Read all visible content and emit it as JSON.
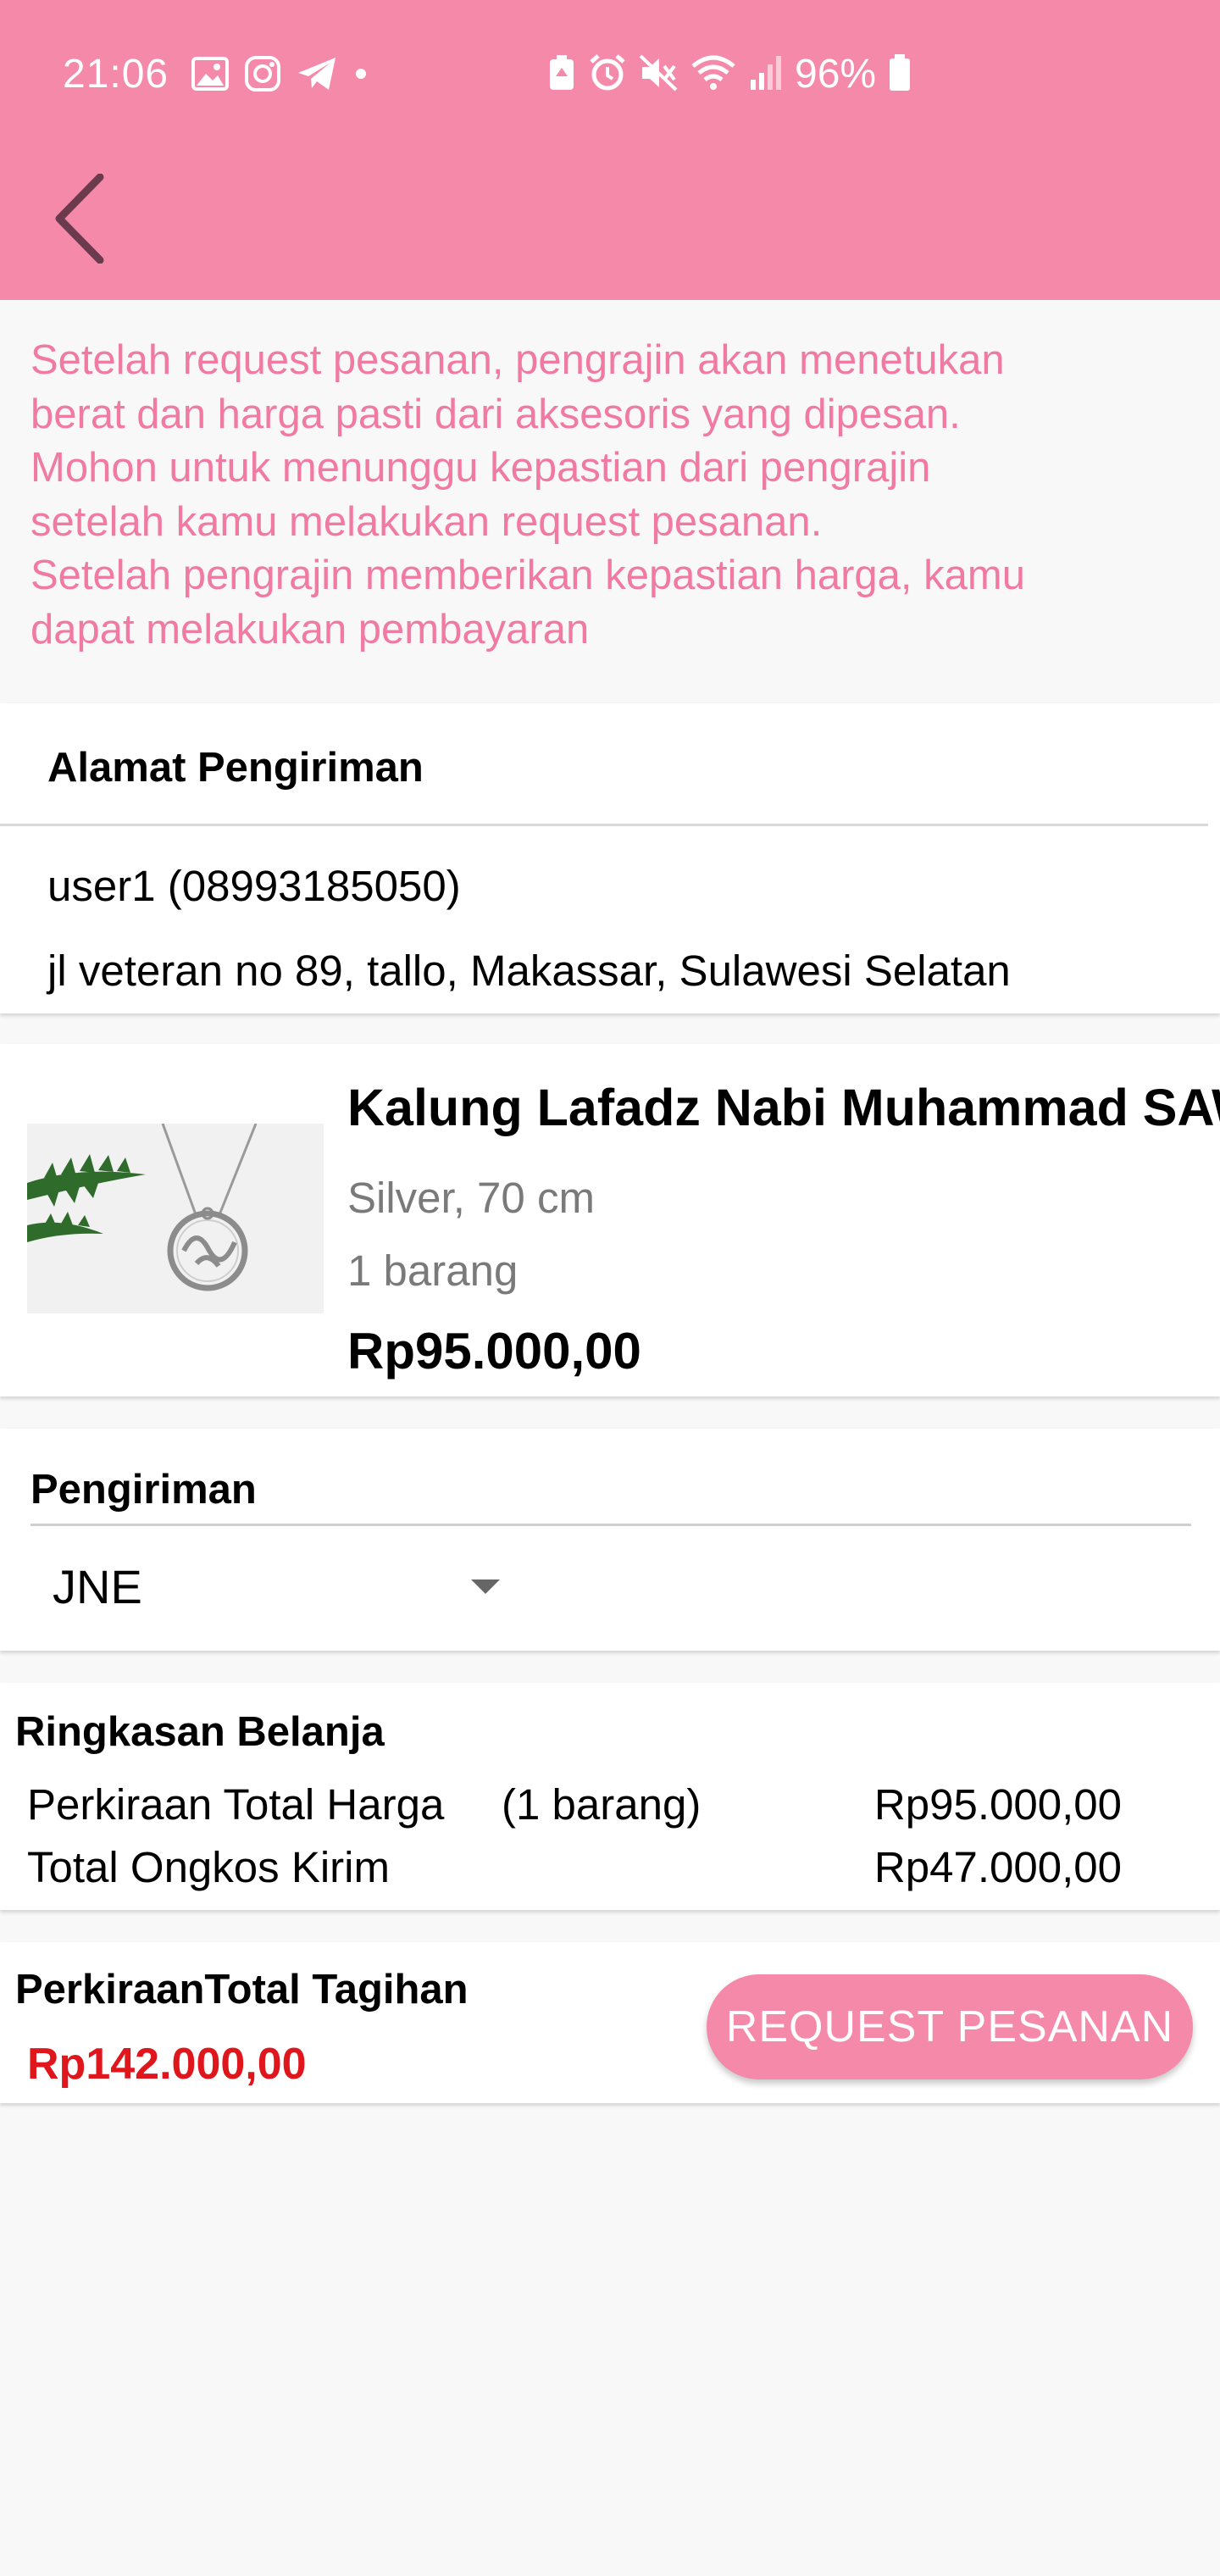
{
  "status_bar": {
    "time": "21:06",
    "battery": "96%",
    "left_icons": [
      "image-icon",
      "instagram-icon",
      "telegram-icon",
      "dot-icon"
    ],
    "right_icons": [
      "battery-saver-icon",
      "alarm-icon",
      "mute-icon",
      "wifi-icon",
      "signal-icon",
      "battery-icon"
    ]
  },
  "header": {
    "back_icon": "chevron-left-icon",
    "color": "#f589aa"
  },
  "info": {
    "text": "Setelah request pesanan, pengrajin akan menetukan\nberat dan harga pasti dari aksesoris yang dipesan.\n Mohon untuk menunggu kepastian dari pengrajin\nsetelah kamu melakukan request pesanan.\nSetelah pengrajin memberikan kepastian harga, kamu\ndapat melakukan pembayaran",
    "color": "#f07aa2"
  },
  "address": {
    "title": "Alamat Pengiriman",
    "name": "user1 (08993185050)",
    "line": "jl veteran no 89, tallo, Makassar, Sulawesi Selatan"
  },
  "product": {
    "name": "Kalung Lafadz Nabi Muhammad SAW",
    "variant": "Silver, 70 cm",
    "qty": "1 barang",
    "price": "Rp95.000,00"
  },
  "shipping": {
    "title": "Pengiriman",
    "selected": "JNE"
  },
  "summary": {
    "title": "Ringkasan Belanja",
    "rows": [
      {
        "label": "Perkiraan Total Harga",
        "qty": "(1 barang)",
        "value": "Rp95.000,00"
      },
      {
        "label": "Total Ongkos Kirim",
        "qty": "",
        "value": "Rp47.000,00"
      }
    ]
  },
  "total": {
    "label": "PerkiraanTotal Tagihan",
    "value": "Rp142.000,00",
    "value_color": "#e0161d",
    "button": "REQUEST PESANAN"
  }
}
